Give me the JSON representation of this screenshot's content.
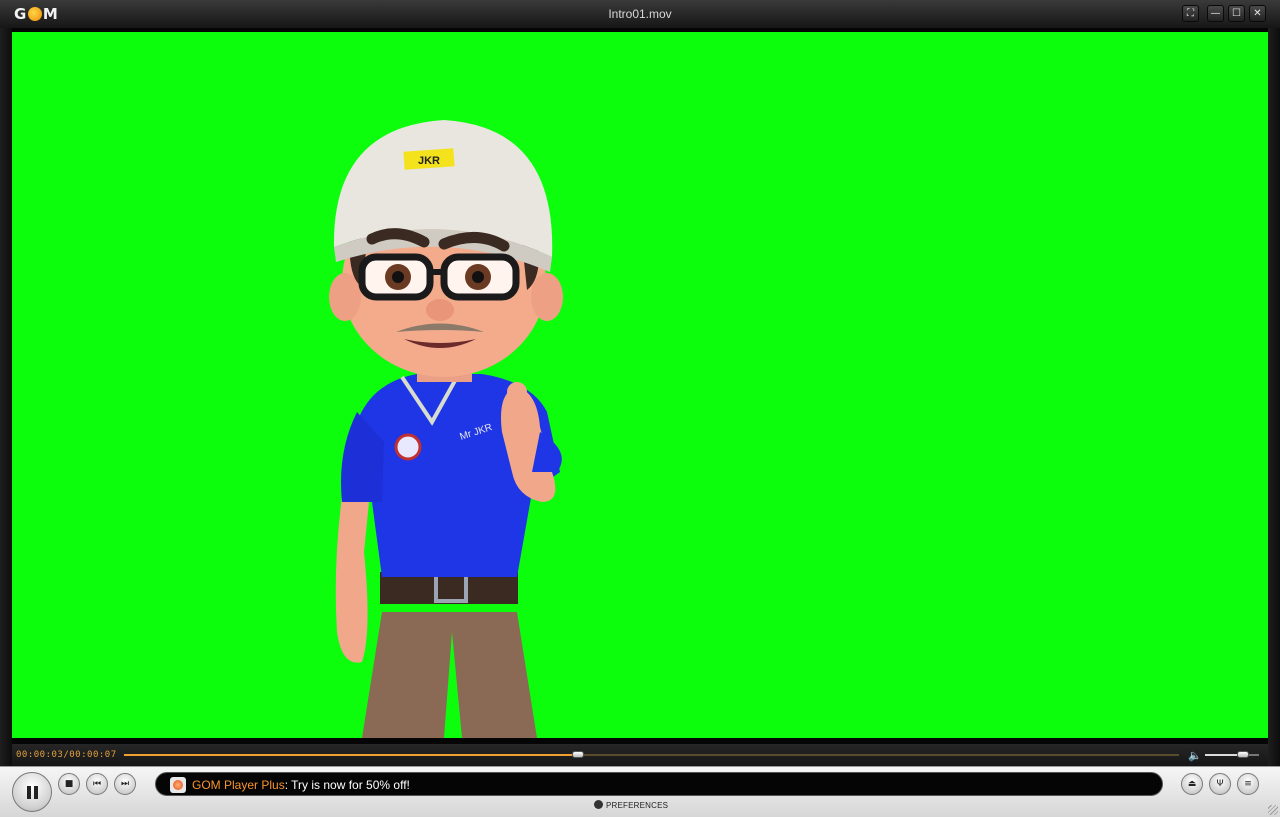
{
  "app": {
    "logo_text": "GOM",
    "window_title": "Intro01.mov"
  },
  "window_buttons": [
    "⛶",
    "—",
    "☐",
    "✕"
  ],
  "video": {
    "background_color": "#0cfe0c",
    "content": "3D animated character in a white JKR hard hat, glasses and blue polo shirt pointing forward",
    "hat_badge": "JKR",
    "shirt_label": "Mr JKR"
  },
  "seek": {
    "time_display": "00:00:03/00:00:07",
    "progress_fraction": 0.43,
    "volume_fraction": 0.7
  },
  "controls": {
    "pause_label": "Pause",
    "stop_icon": "■",
    "prev_icon": "⏮",
    "next_icon": "⏭",
    "eject_icon": "⏏",
    "settings_icon": "Ψ",
    "menu_icon": "≡"
  },
  "ad": {
    "brand": "GOM Player Plus",
    "message": ": Try is now for 50% off!"
  },
  "preferences_label": "PREFERENCES"
}
